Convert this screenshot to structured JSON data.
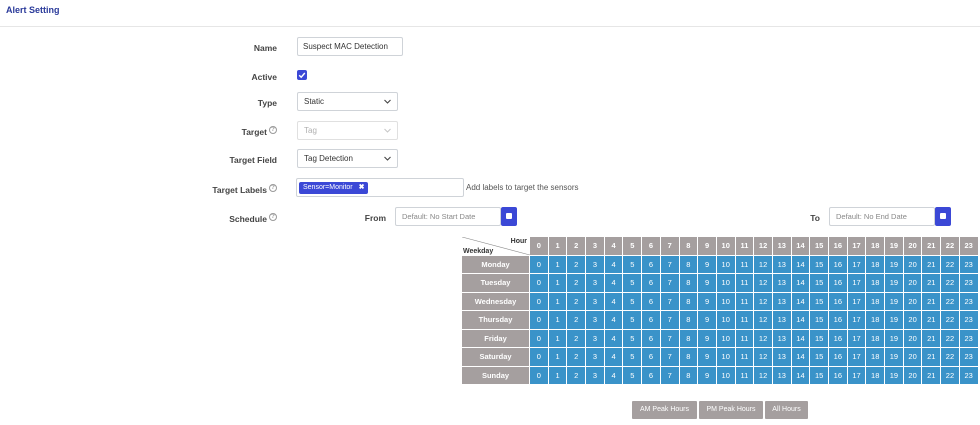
{
  "page": {
    "title": "Alert Setting"
  },
  "form": {
    "name": {
      "label": "Name",
      "value": "Suspect MAC Detection"
    },
    "active": {
      "label": "Active",
      "checked": true
    },
    "type": {
      "label": "Type",
      "value": "Static"
    },
    "target": {
      "label": "Target",
      "value": "Tag",
      "disabled": true
    },
    "target_field": {
      "label": "Target Field",
      "value": "Tag Detection"
    },
    "target_labels": {
      "label": "Target Labels",
      "chips": [
        "Sensor=Monitor"
      ],
      "hint": "Add labels to target the sensors"
    },
    "schedule": {
      "label": "Schedule",
      "from_label": "From",
      "from_placeholder": "Default: No Start Date",
      "to_label": "To",
      "to_placeholder": "Default: No End Date"
    }
  },
  "schedule_table": {
    "corner_hour": "Hour",
    "corner_weekday": "Weekday",
    "hours": [
      "0",
      "1",
      "2",
      "3",
      "4",
      "5",
      "6",
      "7",
      "8",
      "9",
      "10",
      "11",
      "12",
      "13",
      "14",
      "15",
      "16",
      "17",
      "18",
      "19",
      "20",
      "21",
      "22",
      "23"
    ],
    "days": [
      "Monday",
      "Tuesday",
      "Wednesday",
      "Thursday",
      "Friday",
      "Saturday",
      "Sunday"
    ]
  },
  "quick_buttons": {
    "am": "AM Peak Hours",
    "pm": "PM Peak Hours",
    "all": "All Hours"
  },
  "colors": {
    "accent": "#3b48d6",
    "cell_selected": "#3a93c9",
    "header_gray": "#a59f9f",
    "title": "#2a3a9a"
  }
}
